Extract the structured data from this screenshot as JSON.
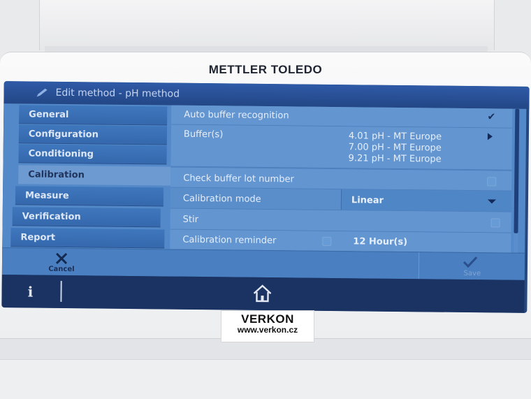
{
  "brand": {
    "name": "METTLER TOLEDO"
  },
  "title_bar": {
    "title": "Edit method - pH method",
    "icon": "pencil-icon"
  },
  "sidebar": {
    "items": [
      {
        "label": "General",
        "active": false
      },
      {
        "label": "Configuration",
        "active": false
      },
      {
        "label": "Conditioning",
        "active": false
      },
      {
        "label": "Calibration",
        "active": true
      },
      {
        "label": "Measure",
        "active": false
      },
      {
        "label": "Verification",
        "active": false
      },
      {
        "label": "Report",
        "active": false
      }
    ]
  },
  "settings": {
    "auto_buffer": {
      "label": "Auto buffer recognition",
      "checked": true
    },
    "buffers": {
      "label": "Buffer(s)",
      "values": [
        "4.01 pH - MT Europe",
        "7.00 pH - MT Europe",
        "9.21 pH - MT Europe"
      ]
    },
    "check_lot": {
      "label": "Check buffer lot number",
      "checked": false
    },
    "calibration_mode": {
      "label": "Calibration mode",
      "value": "Linear"
    },
    "stir": {
      "label": "Stir",
      "checked": false
    },
    "reminder": {
      "label": "Calibration reminder",
      "checked": false,
      "value": "12 Hour(s)"
    }
  },
  "actions": {
    "cancel_label": "Cancel",
    "save_label": "Save"
  },
  "footer": {
    "info_label": "i"
  },
  "sticker": {
    "name": "VERKON",
    "url": "www.verkon.cz"
  },
  "colors": {
    "screen_bg": "#5389c8",
    "title_bar": "#2f5aa7",
    "footer_bar": "#1b3362"
  }
}
